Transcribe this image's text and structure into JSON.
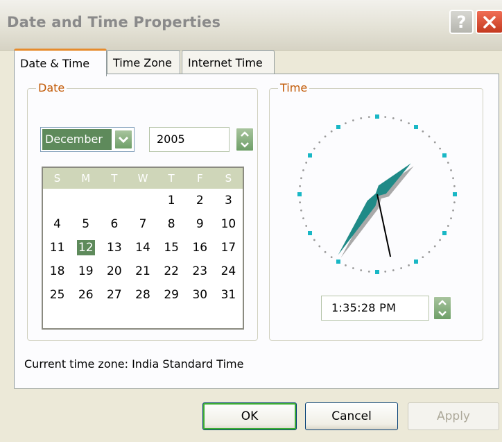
{
  "window": {
    "title": "Date and Time Properties",
    "help_glyph": "?"
  },
  "tabs": [
    {
      "label": "Date & Time",
      "active": true
    },
    {
      "label": "Time Zone",
      "active": false
    },
    {
      "label": "Internet Time",
      "active": false
    }
  ],
  "date_group": {
    "title": "Date",
    "month": "December",
    "year": "2005",
    "weekday_headers": [
      "S",
      "M",
      "T",
      "W",
      "T",
      "F",
      "S"
    ],
    "days": [
      [
        "",
        "",
        "",
        "",
        "1",
        "2",
        "3"
      ],
      [
        "4",
        "5",
        "6",
        "7",
        "8",
        "9",
        "10"
      ],
      [
        "11",
        "12",
        "13",
        "14",
        "15",
        "16",
        "17"
      ],
      [
        "18",
        "19",
        "20",
        "21",
        "22",
        "23",
        "24"
      ],
      [
        "25",
        "26",
        "27",
        "28",
        "29",
        "30",
        "31"
      ]
    ],
    "selected_day": "12"
  },
  "time_group": {
    "title": "Time",
    "time_value": "1:35:28 PM",
    "clock": {
      "hour": 1,
      "minute": 35,
      "second": 28
    }
  },
  "timezone_label": "Current time zone:  India Standard Time",
  "buttons": {
    "ok": "OK",
    "cancel": "Cancel",
    "apply": "Apply"
  },
  "colors": {
    "accent": "#5e8a5b",
    "tab_highlight": "#e68b2c",
    "group_title": "#c25a06",
    "clock_hand": "#1f8a87",
    "clock_marker": "#19b7c5"
  }
}
